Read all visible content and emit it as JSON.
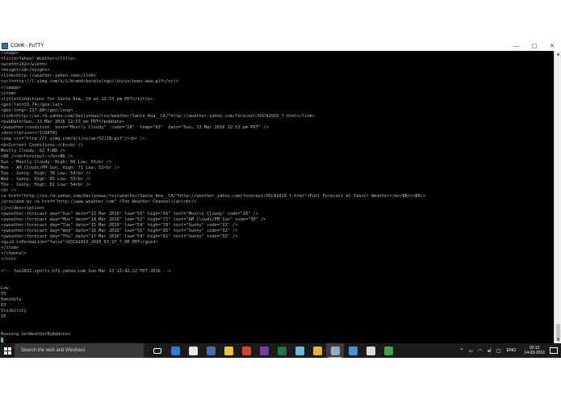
{
  "window": {
    "title": "COM6 - PuTTY",
    "minimize": "—",
    "maximize": "□",
    "close": "✕"
  },
  "terminal": {
    "lines": [
      "<image>",
      "<title>Yahoo! Weather</title>",
      "<width>142</width>",
      "<height>18</height>",
      "<link>http://weather.yahoo.com</link>",
      "<url>http://l.yimg.com/a/i/brand/purplelogo//uh/us/news-wea.gif</url>",
      "</image>",
      "<item>",
      "<title>Conditions for Santa Ana, CA at 12:53 pm PDT</title>",
      "<geo:lat>33.74</geo:lat>",
      "<geo:long>-117.88</geo:long>",
      "<link>http://us.rd.yahoo.com/dailynews/rss/weather/Santa_Ana__CA/*http://weather.yahoo.com/forecast/USCA1016_f.html</link>",
      "<pubDate>Sun, 13 Mar 2016 12:53 pm PDT</pubDate>",
      "<yweather:condition  text=\"Mostly Cloudy\"  code=\"28\"  temp=\"63\"  date=\"Sun, 13 Mar 2016 12:53 pm PDT\" />",
      "<description><![CDATA[",
      "<img src=\"http://l.yimg.com/a/i/us/we/52/28.gif\"/><br />",
      "<b>Current Conditions:</b><br />",
      "Mostly Cloudy, 63 F<BR />",
      "<BR /><b>Forecast:</b><BR />",
      "Sun - Mostly Cloudy. High: 66 Low: 55<br />",
      "Mon - AM Clouds/PM Sun. High: 71 Low: 52<br />",
      "Tue - Sunny. High: 78 Low: 54<br />",
      "Wed - Sunny. High: 85 Low: 55<br />",
      "Thu - Sunny. High: 81 Low: 54<br />",
      "<br />",
      "<a href=\"http://us.rd.yahoo.com/dailynews/rss/weather/Santa_Ana__CA/*http://weather.yahoo.com/forecast/USCA1016_f.html\">Full Forecast at Yahoo! Weather</a><BR/><BR/>",
      "(provided by <a href=\"http://www.weather.com\" >The Weather Channel</a>)<br/>",
      "]]></description>",
      "<yweather:forecast day=\"Sun\" date=\"13 Mar 2016\" low=\"55\" high=\"66\" text=\"Mostly Cloudy\" code=\"28\" />",
      "<yweather:forecast day=\"Mon\" date=\"14 Mar 2016\" low=\"52\" high=\"71\" text=\"AM Clouds/PM Sun\" code=\"30\" />",
      "<yweather:forecast day=\"Tue\" date=\"15 Mar 2016\" low=\"54\" high=\"78\" text=\"Sunny\" code=\"32\" />",
      "<yweather:forecast day=\"Wed\" date=\"16 Mar 2016\" low=\"55\" high=\"85\" text=\"Sunny\" code=\"32\" />",
      "<yweather:forecast day=\"Thu\" date=\"17 Mar 2016\" low=\"54\" high=\"81\" text=\"Sunny\" code=\"32\" />",
      "<guid isPermaLink=\"false\">USCA1016_2016_03_17_7_00_PDT</guid>",
      "</item>",
      "</channel>",
      "</rss>",
      "",
      "<!-- fan1631.sports.bf1.yahoo.com Sun Mar 13 13:42:22 PDT 2016 -->",
      "",
      "",
      "Low",
      "55",
      "Humidity",
      "63",
      "Visibility",
      "10",
      "",
      "",
      "Running GetWeatherByAddress"
    ]
  },
  "taskbar": {
    "search_placeholder": "Search the web and Windows",
    "apps": [
      {
        "name": "task-view-icon",
        "color": "#ffffff"
      },
      {
        "name": "edge-icon",
        "color": "#2f7bd6"
      },
      {
        "name": "store-icon",
        "color": "#e6e6e6"
      },
      {
        "name": "firefox-icon",
        "color": "#4a6ea8"
      },
      {
        "name": "file-explorer-icon",
        "color": "#f0c03a"
      },
      {
        "name": "powerpoint-icon",
        "color": "#d24726"
      },
      {
        "name": "onenote-icon",
        "color": "#7a3b9e"
      },
      {
        "name": "excel-icon",
        "color": "#217346"
      },
      {
        "name": "app-icon",
        "color": "#6bbcd9"
      },
      {
        "name": "chrome-icon",
        "color": "#e8b23a"
      },
      {
        "name": "putty-icon",
        "color": "#9aa8c8"
      },
      {
        "name": "photos-icon",
        "color": "#4a90d9"
      },
      {
        "name": "cmd-icon",
        "color": "#dcdcdc"
      },
      {
        "name": "arduino-icon",
        "color": "#3fa34d"
      }
    ],
    "active_app": "putty-icon",
    "tray": {
      "chevron": "^",
      "language": "ENG",
      "time": "02:12",
      "date": "14-03-2016"
    }
  }
}
